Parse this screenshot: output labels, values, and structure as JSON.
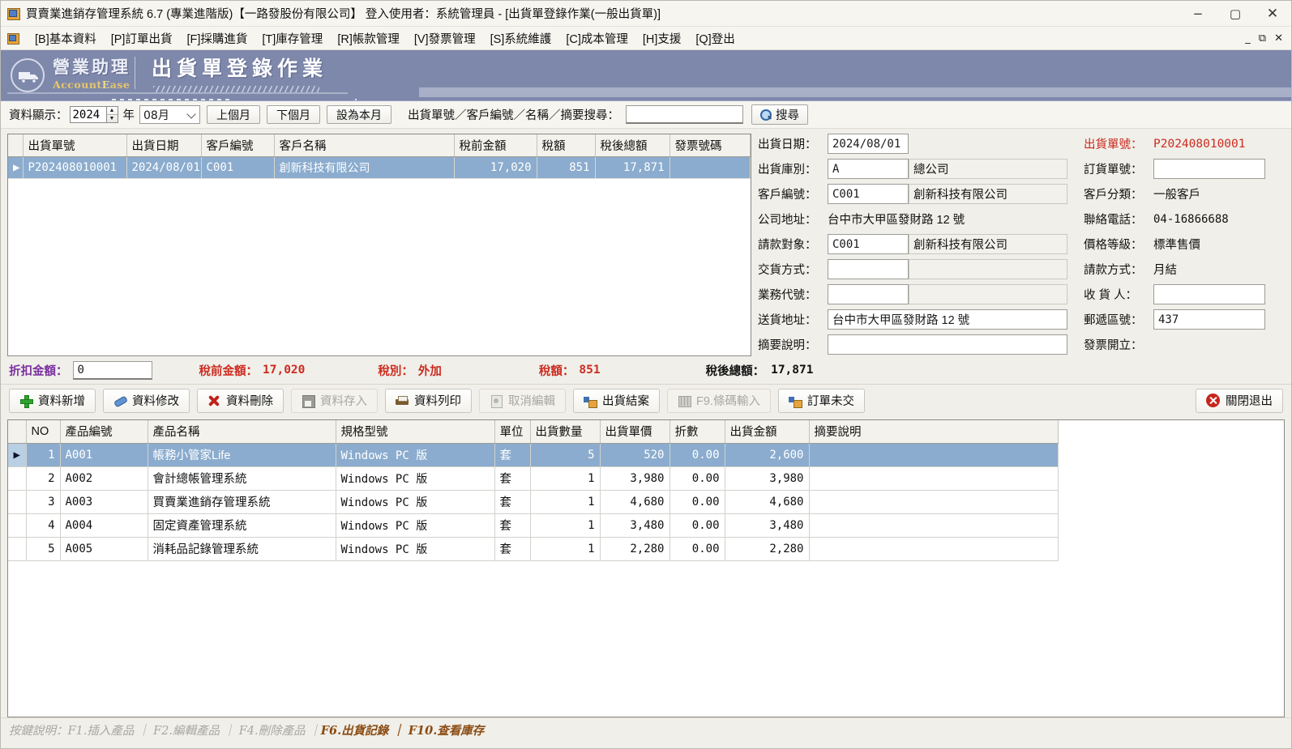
{
  "window": {
    "title": "買賣業進銷存管理系統 6.7 (專業進階版)【一路發股份有限公司】 登入使用者：系統管理員 - [出貨單登錄作業(一般出貨單)]",
    "minimize": "−",
    "maximize": "▢",
    "close": "✕",
    "mdi_minimize": "_",
    "mdi_restore": "⧉",
    "mdi_close": "✕"
  },
  "menu": {
    "items": [
      {
        "label": "[B]基本資料"
      },
      {
        "label": "[P]訂單出貨"
      },
      {
        "label": "[F]採購進貨"
      },
      {
        "label": "[T]庫存管理"
      },
      {
        "label": "[R]帳款管理"
      },
      {
        "label": "[V]發票管理"
      },
      {
        "label": "[S]系統維護"
      },
      {
        "label": "[C]成本管理"
      },
      {
        "label": "[H]支援"
      },
      {
        "label": "[Q]登出"
      }
    ]
  },
  "banner": {
    "brand_cn": "營業助理",
    "brand_en_a": "Account",
    "brand_en_b": "E",
    "brand_en_c": "ase",
    "page_title": "出貨單登錄作業",
    "logo_icon": "truck-icon"
  },
  "filter": {
    "display_label": "資料顯示：",
    "year_value": "2024",
    "year_unit": "年",
    "month_value": "08月",
    "prev_month": "上個月",
    "next_month": "下個月",
    "set_this_month": "設為本月",
    "search_label": "出貨單號／客戶編號／名稱／摘要搜尋：",
    "search_value": "",
    "search_placeholder": "",
    "search_button": "搜尋"
  },
  "master_grid": {
    "columns": [
      "出貨單號",
      "出貨日期",
      "客戶編號",
      "客戶名稱",
      "稅前金額",
      "稅額",
      "稅後總額",
      "發票號碼"
    ],
    "rows": [
      {
        "selected": true,
        "出貨單號": "P202408010001",
        "出貨日期": "2024/08/01",
        "客戶編號": "C001",
        "客戶名稱": "創新科技有限公司",
        "稅前金額": "17,020",
        "稅額": "851",
        "稅後總額": "17,871",
        "發票號碼": ""
      }
    ]
  },
  "form": {
    "left": [
      {
        "label": "出貨日期：",
        "value": "2024/08/01",
        "type": "input",
        "extra": null
      },
      {
        "label": "出貨庫別：",
        "value": "A",
        "type": "input",
        "extra": "總公司"
      },
      {
        "label": "客戶編號：",
        "value": "C001",
        "type": "input",
        "extra": "創新科技有限公司"
      },
      {
        "label": "公司地址：",
        "value": "台中市大甲區發財路 12 號",
        "type": "text",
        "extra": null
      },
      {
        "label": "請款對象：",
        "value": "C001",
        "type": "input",
        "extra": "創新科技有限公司"
      },
      {
        "label": "交貨方式：",
        "value": "",
        "type": "input",
        "extra": ""
      },
      {
        "label": "業務代號：",
        "value": "",
        "type": "input",
        "extra": ""
      },
      {
        "label": "送貨地址：",
        "value": "台中市大甲區發財路 12 號",
        "type": "wideinput",
        "extra": null
      },
      {
        "label": "摘要說明：",
        "value": "",
        "type": "wideinput",
        "extra": null
      }
    ],
    "right": [
      {
        "label": "出貨單號：",
        "value": "P202408010001",
        "type": "red"
      },
      {
        "label": "訂貨單號：",
        "value": "",
        "type": "input"
      },
      {
        "label": "客戶分類：",
        "value": "一般客戶",
        "type": "text"
      },
      {
        "label": "聯絡電話：",
        "value": "04-16866688",
        "type": "text"
      },
      {
        "label": "價格等級：",
        "value": "標準售價",
        "type": "text"
      },
      {
        "label": "請款方式：",
        "value": "月結",
        "type": "text"
      },
      {
        "label": "收 貨 人：",
        "value": "",
        "type": "input"
      },
      {
        "label": "郵遞區號：",
        "value": "437",
        "type": "input"
      },
      {
        "label": "發票開立：",
        "value": "",
        "type": "text"
      }
    ]
  },
  "totals": {
    "discount_label": "折扣金額：",
    "discount_value": "0",
    "pretax_label": "稅前金額：",
    "pretax_value": "17,020",
    "taxtype_label": "稅別：",
    "taxtype_value": "外加",
    "tax_label": "稅額：",
    "tax_value": "851",
    "total_label": "稅後總額：",
    "total_value": "17,871"
  },
  "toolbar": {
    "buttons": [
      {
        "label": "資料新增",
        "icon": "plus-icon",
        "disabled": false
      },
      {
        "label": "資料修改",
        "icon": "pencil-icon",
        "disabled": false
      },
      {
        "label": "資料刪除",
        "icon": "delete-x-icon",
        "disabled": false
      },
      {
        "label": "資料存入",
        "icon": "save-icon",
        "disabled": true
      },
      {
        "label": "資料列印",
        "icon": "printer-icon",
        "disabled": false
      },
      {
        "label": "取消編輯",
        "icon": "page-cancel-icon",
        "disabled": true
      },
      {
        "label": "出貨結案",
        "icon": "blocks-icon",
        "disabled": false
      },
      {
        "label": "F9.條碼輸入",
        "icon": "barcode-grid-icon",
        "disabled": true
      },
      {
        "label": "訂單未交",
        "icon": "blocks-icon",
        "disabled": false
      }
    ],
    "exit_label": "關閉退出",
    "exit_icon": "close-circle-icon"
  },
  "detail_grid": {
    "columns": [
      "NO",
      "產品編號",
      "產品名稱",
      "規格型號",
      "單位",
      "出貨數量",
      "出貨單價",
      "折數",
      "出貨金額",
      "摘要說明"
    ],
    "rows": [
      {
        "selected": true,
        "NO": "1",
        "產品編號": "A001",
        "產品名稱": "帳務小管家Life",
        "規格型號": "Windows PC 版",
        "單位": "套",
        "出貨數量": "5",
        "出貨單價": "520",
        "折數": "0.00",
        "出貨金額": "2,600",
        "摘要說明": ""
      },
      {
        "selected": false,
        "NO": "2",
        "產品編號": "A002",
        "產品名稱": "會計總帳管理系統",
        "規格型號": "Windows PC 版",
        "單位": "套",
        "出貨數量": "1",
        "出貨單價": "3,980",
        "折數": "0.00",
        "出貨金額": "3,980",
        "摘要說明": ""
      },
      {
        "selected": false,
        "NO": "3",
        "產品編號": "A003",
        "產品名稱": "買賣業進銷存管理系統",
        "規格型號": "Windows PC 版",
        "單位": "套",
        "出貨數量": "1",
        "出貨單價": "4,680",
        "折數": "0.00",
        "出貨金額": "4,680",
        "摘要說明": ""
      },
      {
        "selected": false,
        "NO": "4",
        "產品編號": "A004",
        "產品名稱": "固定資產管理系統",
        "規格型號": "Windows PC 版",
        "單位": "套",
        "出貨數量": "1",
        "出貨單價": "3,480",
        "折數": "0.00",
        "出貨金額": "3,480",
        "摘要說明": ""
      },
      {
        "selected": false,
        "NO": "5",
        "產品編號": "A005",
        "產品名稱": "消耗品記錄管理系統",
        "規格型號": "Windows PC 版",
        "單位": "套",
        "出貨數量": "1",
        "出貨單價": "2,280",
        "折數": "0.00",
        "出貨金額": "2,280",
        "摘要說明": ""
      }
    ]
  },
  "status": {
    "prefix": "按鍵說明：F1.插入產品 ｜ F2.編輯產品 ｜ F4.刪除產品 ｜ ",
    "hot": "F6.出貨記錄 ｜ F10.查看庫存"
  },
  "colors": {
    "banner": "#7e88ab",
    "selection": "#8bacce",
    "accent_red": "#cc2b20",
    "accent_purple": "#7a2fa0",
    "status_hot": "#8a4b12",
    "window_bg": "#f0efe9"
  }
}
